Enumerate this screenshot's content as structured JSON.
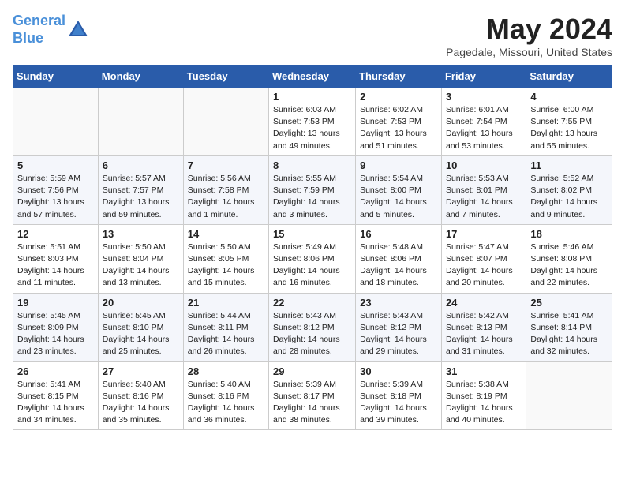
{
  "header": {
    "logo_line1": "General",
    "logo_line2": "Blue",
    "month": "May 2024",
    "location": "Pagedale, Missouri, United States"
  },
  "days_of_week": [
    "Sunday",
    "Monday",
    "Tuesday",
    "Wednesday",
    "Thursday",
    "Friday",
    "Saturday"
  ],
  "weeks": [
    [
      {
        "day": "",
        "info": ""
      },
      {
        "day": "",
        "info": ""
      },
      {
        "day": "",
        "info": ""
      },
      {
        "day": "1",
        "info": "Sunrise: 6:03 AM\nSunset: 7:53 PM\nDaylight: 13 hours\nand 49 minutes."
      },
      {
        "day": "2",
        "info": "Sunrise: 6:02 AM\nSunset: 7:53 PM\nDaylight: 13 hours\nand 51 minutes."
      },
      {
        "day": "3",
        "info": "Sunrise: 6:01 AM\nSunset: 7:54 PM\nDaylight: 13 hours\nand 53 minutes."
      },
      {
        "day": "4",
        "info": "Sunrise: 6:00 AM\nSunset: 7:55 PM\nDaylight: 13 hours\nand 55 minutes."
      }
    ],
    [
      {
        "day": "5",
        "info": "Sunrise: 5:59 AM\nSunset: 7:56 PM\nDaylight: 13 hours\nand 57 minutes."
      },
      {
        "day": "6",
        "info": "Sunrise: 5:57 AM\nSunset: 7:57 PM\nDaylight: 13 hours\nand 59 minutes."
      },
      {
        "day": "7",
        "info": "Sunrise: 5:56 AM\nSunset: 7:58 PM\nDaylight: 14 hours\nand 1 minute."
      },
      {
        "day": "8",
        "info": "Sunrise: 5:55 AM\nSunset: 7:59 PM\nDaylight: 14 hours\nand 3 minutes."
      },
      {
        "day": "9",
        "info": "Sunrise: 5:54 AM\nSunset: 8:00 PM\nDaylight: 14 hours\nand 5 minutes."
      },
      {
        "day": "10",
        "info": "Sunrise: 5:53 AM\nSunset: 8:01 PM\nDaylight: 14 hours\nand 7 minutes."
      },
      {
        "day": "11",
        "info": "Sunrise: 5:52 AM\nSunset: 8:02 PM\nDaylight: 14 hours\nand 9 minutes."
      }
    ],
    [
      {
        "day": "12",
        "info": "Sunrise: 5:51 AM\nSunset: 8:03 PM\nDaylight: 14 hours\nand 11 minutes."
      },
      {
        "day": "13",
        "info": "Sunrise: 5:50 AM\nSunset: 8:04 PM\nDaylight: 14 hours\nand 13 minutes."
      },
      {
        "day": "14",
        "info": "Sunrise: 5:50 AM\nSunset: 8:05 PM\nDaylight: 14 hours\nand 15 minutes."
      },
      {
        "day": "15",
        "info": "Sunrise: 5:49 AM\nSunset: 8:06 PM\nDaylight: 14 hours\nand 16 minutes."
      },
      {
        "day": "16",
        "info": "Sunrise: 5:48 AM\nSunset: 8:06 PM\nDaylight: 14 hours\nand 18 minutes."
      },
      {
        "day": "17",
        "info": "Sunrise: 5:47 AM\nSunset: 8:07 PM\nDaylight: 14 hours\nand 20 minutes."
      },
      {
        "day": "18",
        "info": "Sunrise: 5:46 AM\nSunset: 8:08 PM\nDaylight: 14 hours\nand 22 minutes."
      }
    ],
    [
      {
        "day": "19",
        "info": "Sunrise: 5:45 AM\nSunset: 8:09 PM\nDaylight: 14 hours\nand 23 minutes."
      },
      {
        "day": "20",
        "info": "Sunrise: 5:45 AM\nSunset: 8:10 PM\nDaylight: 14 hours\nand 25 minutes."
      },
      {
        "day": "21",
        "info": "Sunrise: 5:44 AM\nSunset: 8:11 PM\nDaylight: 14 hours\nand 26 minutes."
      },
      {
        "day": "22",
        "info": "Sunrise: 5:43 AM\nSunset: 8:12 PM\nDaylight: 14 hours\nand 28 minutes."
      },
      {
        "day": "23",
        "info": "Sunrise: 5:43 AM\nSunset: 8:12 PM\nDaylight: 14 hours\nand 29 minutes."
      },
      {
        "day": "24",
        "info": "Sunrise: 5:42 AM\nSunset: 8:13 PM\nDaylight: 14 hours\nand 31 minutes."
      },
      {
        "day": "25",
        "info": "Sunrise: 5:41 AM\nSunset: 8:14 PM\nDaylight: 14 hours\nand 32 minutes."
      }
    ],
    [
      {
        "day": "26",
        "info": "Sunrise: 5:41 AM\nSunset: 8:15 PM\nDaylight: 14 hours\nand 34 minutes."
      },
      {
        "day": "27",
        "info": "Sunrise: 5:40 AM\nSunset: 8:16 PM\nDaylight: 14 hours\nand 35 minutes."
      },
      {
        "day": "28",
        "info": "Sunrise: 5:40 AM\nSunset: 8:16 PM\nDaylight: 14 hours\nand 36 minutes."
      },
      {
        "day": "29",
        "info": "Sunrise: 5:39 AM\nSunset: 8:17 PM\nDaylight: 14 hours\nand 38 minutes."
      },
      {
        "day": "30",
        "info": "Sunrise: 5:39 AM\nSunset: 8:18 PM\nDaylight: 14 hours\nand 39 minutes."
      },
      {
        "day": "31",
        "info": "Sunrise: 5:38 AM\nSunset: 8:19 PM\nDaylight: 14 hours\nand 40 minutes."
      },
      {
        "day": "",
        "info": ""
      }
    ]
  ]
}
